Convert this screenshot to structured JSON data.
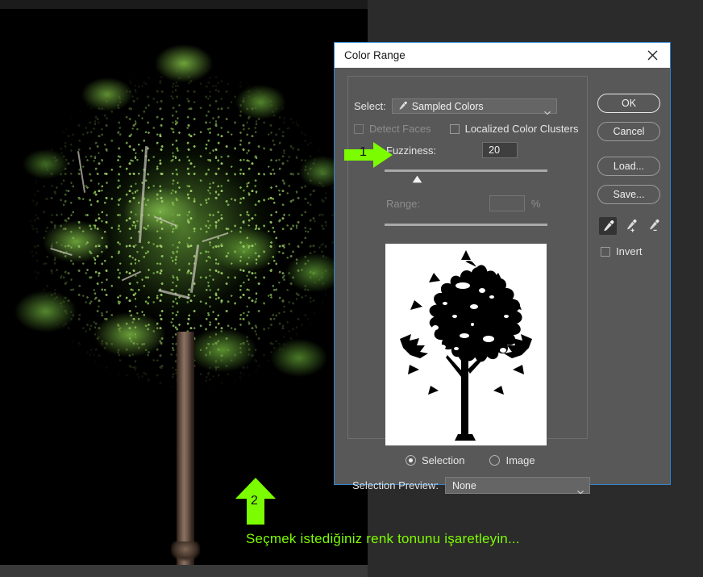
{
  "dialog": {
    "title": "Color Range",
    "close_icon": "close-icon",
    "select": {
      "label": "Select:",
      "value": "Sampled Colors",
      "icon": "eyedropper-icon",
      "caret_icon": "chevron-down-icon"
    },
    "detect_faces": {
      "label": "Detect Faces",
      "checked": false,
      "enabled": false
    },
    "localized_color_clusters": {
      "label": "Localized Color Clusters",
      "checked": false,
      "enabled": true
    },
    "fuzziness": {
      "label": "Fuzziness:",
      "value": "20",
      "slider_position_pct": 20
    },
    "range": {
      "label": "Range:",
      "value": "",
      "unit": "%",
      "enabled": false
    },
    "preview_mode": {
      "selection": {
        "label": "Selection",
        "selected": true
      },
      "image": {
        "label": "Image",
        "selected": false
      }
    },
    "selection_preview": {
      "label": "Selection Preview:",
      "value": "None",
      "caret_icon": "chevron-down-icon"
    },
    "buttons": {
      "ok": "OK",
      "cancel": "Cancel",
      "load": "Load...",
      "save": "Save..."
    },
    "eyedroppers": [
      {
        "name": "eyedropper-icon",
        "active": true
      },
      {
        "name": "eyedropper-add-icon",
        "active": false
      },
      {
        "name": "eyedropper-subtract-icon",
        "active": false
      }
    ],
    "invert": {
      "label": "Invert",
      "checked": false
    }
  },
  "annotations": {
    "arrow1": {
      "number": "1",
      "direction": "right",
      "color": "#7CFC00"
    },
    "arrow2": {
      "number": "2",
      "direction": "up",
      "color": "#7CFC00"
    },
    "caption": "Seçmek istediğiniz renk tonunu işaretleyin..."
  },
  "colors": {
    "accent_blue": "#2f85d0",
    "dialog_bg": "#585858",
    "titlebar_bg": "#ffffff",
    "app_bg": "#2b2b2b",
    "canvas_bg": "#000000",
    "annotation_green": "#7CFC00"
  }
}
